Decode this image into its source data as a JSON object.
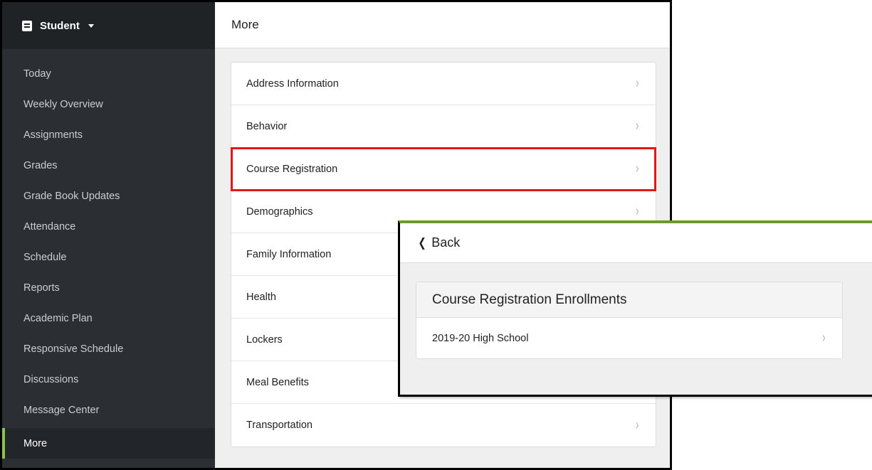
{
  "sidebar": {
    "header": {
      "label": "Student",
      "icon": "book-icon"
    },
    "items": [
      {
        "label": "Today"
      },
      {
        "label": "Weekly Overview"
      },
      {
        "label": "Assignments"
      },
      {
        "label": "Grades"
      },
      {
        "label": "Grade Book Updates"
      },
      {
        "label": "Attendance"
      },
      {
        "label": "Schedule"
      },
      {
        "label": "Reports"
      },
      {
        "label": "Academic Plan"
      },
      {
        "label": "Responsive Schedule"
      },
      {
        "label": "Discussions"
      },
      {
        "label": "Message Center"
      },
      {
        "label": "More"
      }
    ],
    "active": "More",
    "active_accent": "#8bc34a"
  },
  "main": {
    "title": "More",
    "items": [
      {
        "label": "Address Information"
      },
      {
        "label": "Behavior"
      },
      {
        "label": "Course Registration"
      },
      {
        "label": "Demographics"
      },
      {
        "label": "Family Information"
      },
      {
        "label": "Health"
      },
      {
        "label": "Lockers"
      },
      {
        "label": "Meal Benefits"
      },
      {
        "label": "Transportation"
      }
    ],
    "highlight_color": "#e3161a"
  },
  "overlay": {
    "back_label": "Back",
    "card_title": "Course Registration Enrollments",
    "rows": [
      {
        "label": "2019-20 High School"
      }
    ]
  },
  "icons": {
    "chevron": "›",
    "back": "❮"
  }
}
